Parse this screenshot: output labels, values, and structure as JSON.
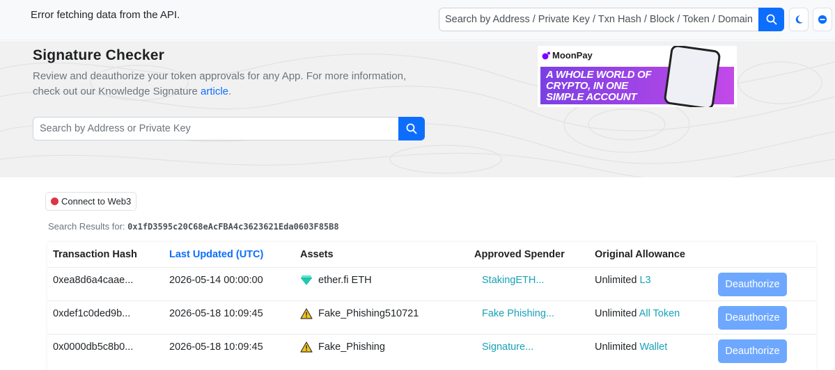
{
  "header": {
    "error_message": "Error fetching data from the API.",
    "search_placeholder": "Search by Address / Private Key / Txn Hash / Block / Token / Domain"
  },
  "hero": {
    "title": "Signature Checker",
    "description_part1": "Review and deauthorize your token approvals for any App. For more information, check out our Knowledge Signature ",
    "article_link": "article",
    "description_end": ".",
    "search_placeholder": "Search by Address or Private Key"
  },
  "ad": {
    "brand": "MoonPay",
    "line1": "A WHOLE WORLD OF",
    "line2": "CRYPTO, IN ONE",
    "line3": "SIMPLE ACCOUNT"
  },
  "connect_button": "Connect to Web3",
  "results": {
    "label": "Search Results for: ",
    "address": "0x1fD3595c20C68eAcFBA4c3623621Eda0603F85B8"
  },
  "table": {
    "headers": {
      "hash": "Transaction Hash",
      "updated": "Last Updated (UTC)",
      "assets": "Assets",
      "spender": "Approved Spender",
      "allowance": "Original Allowance"
    },
    "rows": [
      {
        "hash": "0xea8d6a4caae...",
        "updated": "2026-05-14 00:00:00",
        "asset": "ether.fi ETH",
        "asset_icon": "diamond-icon",
        "spender": "StakingETH...",
        "allowance": "Unlimited",
        "allowance_link": "L3",
        "action": "Deauthorize"
      },
      {
        "hash": "0xdef1c0ded9b...",
        "updated": "2026-05-18 10:09:45",
        "asset": "Fake_Phishing510721",
        "asset_icon": "warning-icon",
        "spender": "Fake Phishing...",
        "allowance": "Unlimited",
        "allowance_link": "All Token",
        "action": "Deauthorize"
      },
      {
        "hash": "0x0000db5c8b0...",
        "updated": "2026-05-18 10:09:45",
        "asset": "Fake_Phishing",
        "asset_icon": "warning-icon",
        "spender": "Signature...",
        "allowance": "Unlimited",
        "allowance_link": "Wallet",
        "action": "Deauthorize"
      }
    ]
  },
  "colors": {
    "primary": "#0d6efd",
    "link_teal": "#17a2b8",
    "deauthorize_button": "#6ea8fe",
    "danger_dot": "#dc3545"
  }
}
